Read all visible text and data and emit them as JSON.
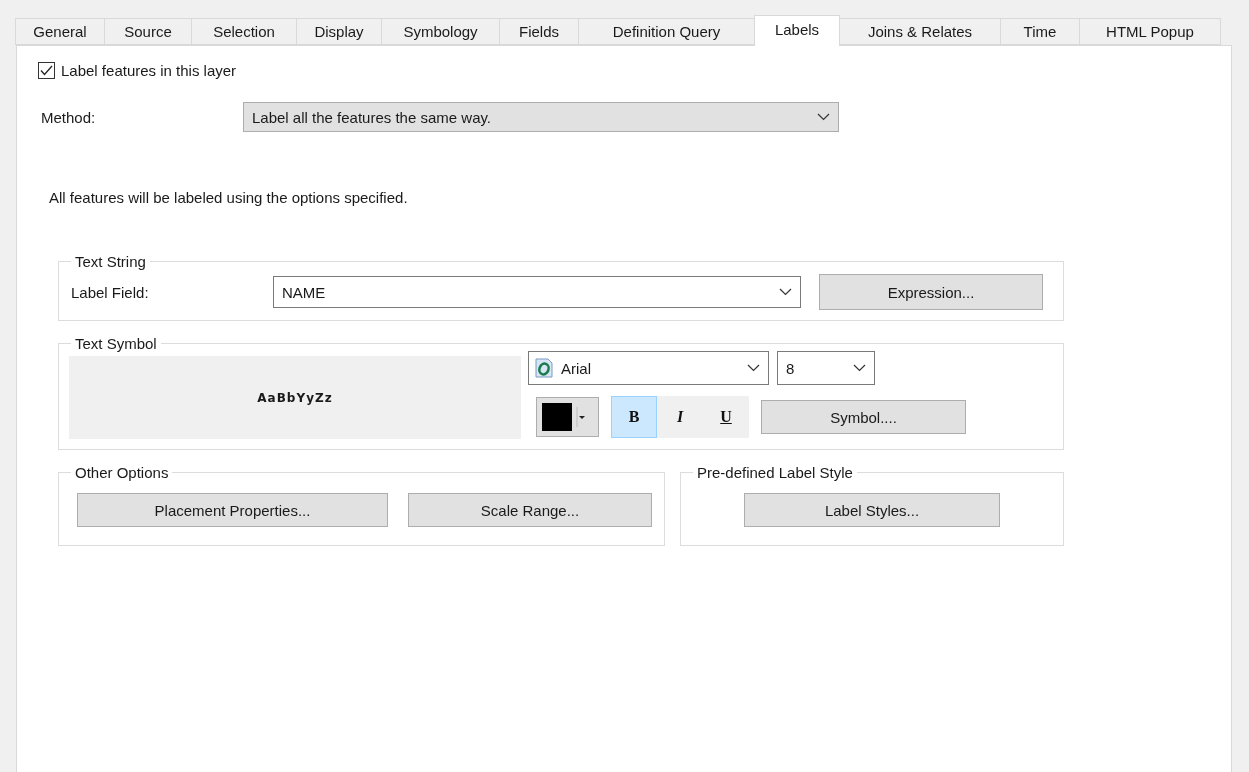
{
  "tabs": [
    {
      "label": "General",
      "selected": false
    },
    {
      "label": "Source",
      "selected": false
    },
    {
      "label": "Selection",
      "selected": false
    },
    {
      "label": "Display",
      "selected": false
    },
    {
      "label": "Symbology",
      "selected": false
    },
    {
      "label": "Fields",
      "selected": false
    },
    {
      "label": "Definition Query",
      "selected": false
    },
    {
      "label": "Labels",
      "selected": true
    },
    {
      "label": "Joins & Relates",
      "selected": false
    },
    {
      "label": "Time",
      "selected": false
    },
    {
      "label": "HTML Popup",
      "selected": false
    }
  ],
  "label_features": {
    "label": "Label features in this layer",
    "checked": true
  },
  "method": {
    "label": "Method:",
    "value": "Label all the features the same way."
  },
  "description": "All features will be labeled using the options specified.",
  "text_string": {
    "title": "Text String",
    "field_label": "Label Field:",
    "field_value": "NAME",
    "expression_button": "Expression..."
  },
  "text_symbol": {
    "title": "Text Symbol",
    "preview": "AaBbYyZz",
    "font": "Arial",
    "size": "8",
    "styles": [
      {
        "label": "B",
        "kind": "bold",
        "selected": true
      },
      {
        "label": "I",
        "kind": "italic",
        "selected": false
      },
      {
        "label": "U",
        "kind": "underline",
        "selected": false
      }
    ],
    "symbol_button": "Symbol...."
  },
  "other_options": {
    "title": "Other Options",
    "buttons": [
      "Placement Properties...",
      "Scale Range..."
    ]
  },
  "predefined_style": {
    "title": "Pre-defined Label Style",
    "button": "Label Styles..."
  }
}
